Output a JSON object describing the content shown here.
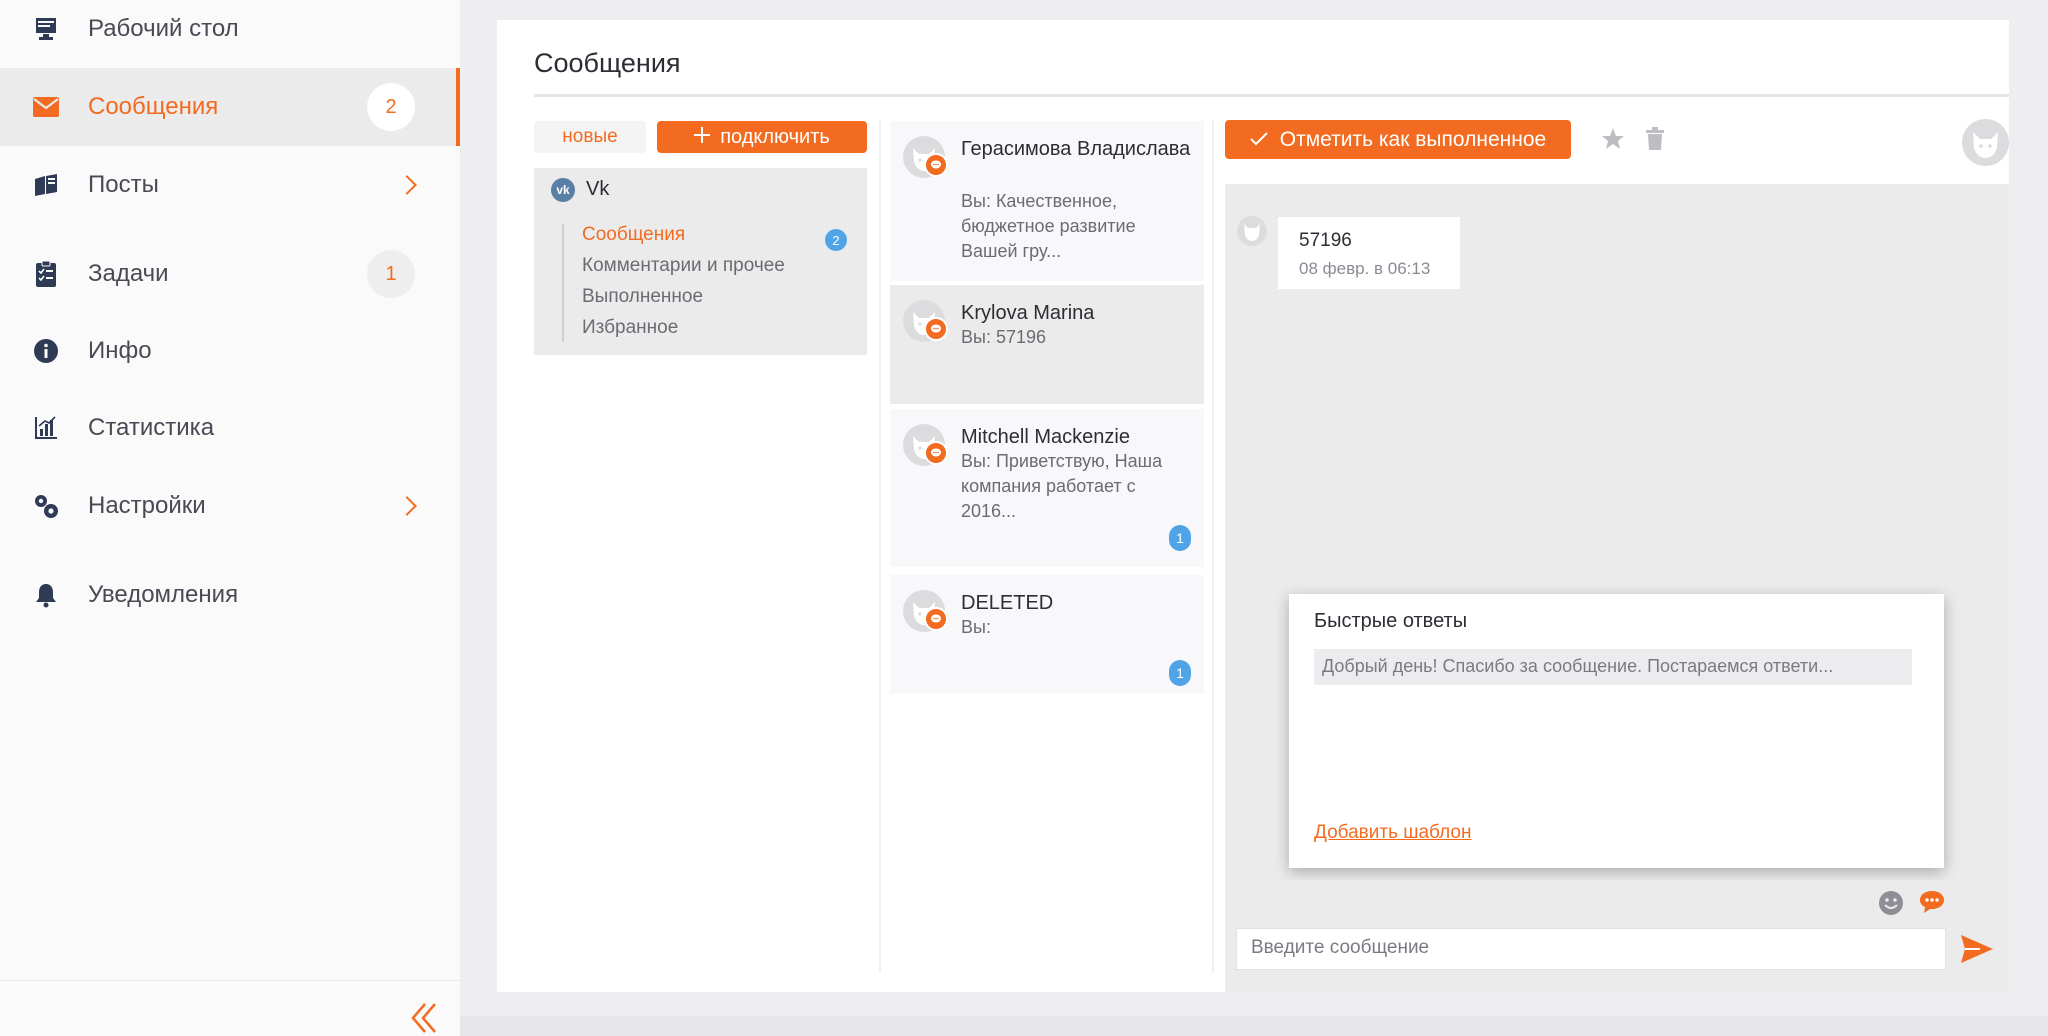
{
  "sidebar": {
    "items": [
      {
        "label": "Рабочий стол",
        "icon": "desktop-icon"
      },
      {
        "label": "Сообщения",
        "icon": "mail-icon",
        "badge": "2",
        "active": true
      },
      {
        "label": "Посты",
        "icon": "posts-icon",
        "chevron": true
      },
      {
        "label": "Задачи",
        "icon": "tasks-icon",
        "badge": "1"
      },
      {
        "label": "Инфо",
        "icon": "info-icon"
      },
      {
        "label": "Статистика",
        "icon": "stats-icon"
      },
      {
        "label": "Настройки",
        "icon": "settings-icon",
        "chevron": true
      },
      {
        "label": "Уведомления",
        "icon": "bell-icon"
      }
    ]
  },
  "page": {
    "title": "Сообщения"
  },
  "sources": {
    "new_label": "новые",
    "connect_label": "подключить",
    "network": "Vk",
    "sub_items": [
      {
        "label": "Сообщения",
        "badge": "2",
        "active": true
      },
      {
        "label": "Комментарии и прочее"
      },
      {
        "label": "Выполненное"
      },
      {
        "label": "Избранное"
      }
    ]
  },
  "conversations": [
    {
      "name": "Герасимова Владислава",
      "preview": "Вы: Качественное, бюджетное развитие Вашей гру..."
    },
    {
      "name": "Krylova Marina",
      "preview": "Вы: 57196",
      "selected": true
    },
    {
      "name": "Mitchell Mackenzie",
      "preview": "Вы: Приветствую, Наша компания работает с 2016...",
      "unread": "1"
    },
    {
      "name": "DELETED",
      "preview": "Вы:",
      "unread": "1"
    }
  ],
  "chat": {
    "mark_done_label": "Отметить как выполненное",
    "message": {
      "text": "57196",
      "time": "08 февр. в 06:13"
    },
    "quick_replies": {
      "title": "Быстрые ответы",
      "items": [
        "Добрый день! Спасибо за сообщение. Постараемся ответи..."
      ],
      "add_label": "Добавить шаблон"
    },
    "input_placeholder": "Введите сообщение"
  },
  "colors": {
    "accent": "#f26b21",
    "badge_blue": "#4fa4e8",
    "panel_grey": "#ebebeb"
  }
}
